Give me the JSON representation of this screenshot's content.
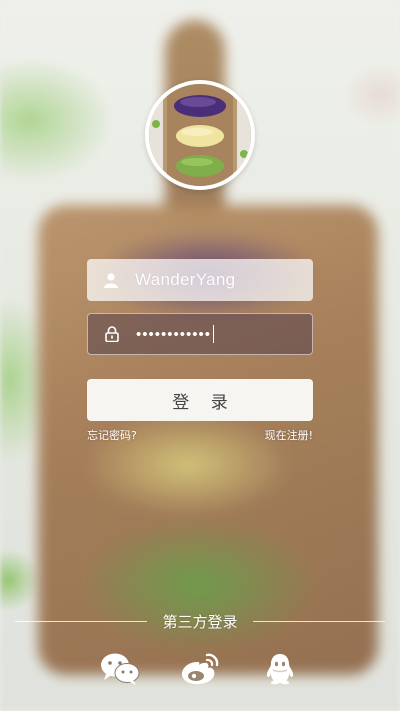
{
  "login": {
    "username_value": "WanderYang",
    "password_masked": "••••••••••••",
    "login_button_label": "登 录",
    "forgot_password_label": "忘记密码?",
    "register_label": "现在注册!"
  },
  "third_party": {
    "title": "第三方登录",
    "providers": [
      {
        "name": "wechat-icon"
      },
      {
        "name": "weibo-icon"
      },
      {
        "name": "qq-icon"
      }
    ]
  },
  "colors": {
    "button_bg": "#f7f5f1",
    "button_text": "#444444",
    "text_light": "#ffffff"
  }
}
